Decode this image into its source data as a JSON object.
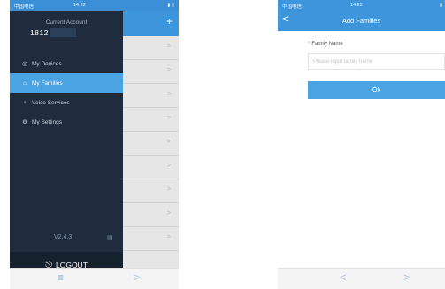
{
  "left_phone": {
    "status_bar": {
      "carrier": "中国电信",
      "time": "14:22",
      "battery": "▮ ▯"
    },
    "drawer": {
      "account_label": "Current Account",
      "account_id": "1812",
      "menu": [
        {
          "label": "My Devices",
          "icon": "circle-icon",
          "glyph": "◎",
          "active": false
        },
        {
          "label": "My Families",
          "icon": "home-icon",
          "glyph": "⌂",
          "active": true
        },
        {
          "label": "Voice Services",
          "icon": "microphone-icon",
          "glyph": "♀",
          "active": false
        },
        {
          "label": "My Settings",
          "icon": "gear-icon",
          "glyph": "⚙",
          "active": false
        }
      ],
      "version": "V2.4.3",
      "logout_label": "LOGOUT"
    },
    "underlay_add_icon": "+",
    "bottom_bar": {
      "menu_glyph": "≡",
      "forward_glyph": ">"
    }
  },
  "right_phone": {
    "status_bar": {
      "carrier": "中国电信",
      "time": "14:22",
      "battery": "▮"
    },
    "nav": {
      "back_glyph": "<",
      "title": "Add Families"
    },
    "form": {
      "required_mark": "*",
      "field_label": "Family Name",
      "placeholder": "Please input family name",
      "value": "",
      "ok_label": "Ok"
    },
    "bottom_bar": {
      "back_glyph": "<",
      "forward_glyph": ">"
    }
  },
  "colors": {
    "accent": "#4aa3e3",
    "header": "#3d95dc",
    "drawer_bg": "#1e2c3d",
    "logout_bg": "#16212e"
  }
}
